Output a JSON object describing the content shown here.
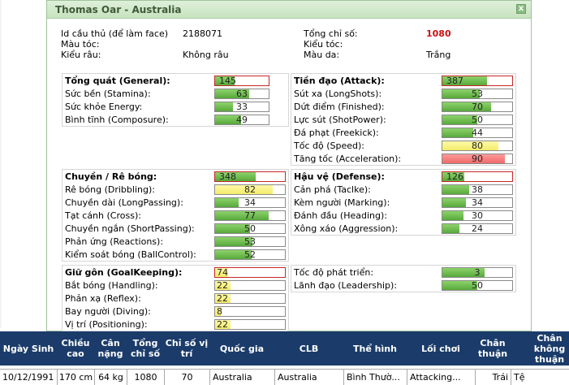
{
  "window": {
    "title": "Thomas Oar - Australia",
    "close_label": "x"
  },
  "info": {
    "player_id_label": "Id cầu thủ (để làm face)",
    "player_id_value": "2188071",
    "hair_color_label": "Màu tóc:",
    "hair_color_value": "",
    "beard_label": "Kiểu râu:",
    "beard_value": "Không râu",
    "total_label": "Tổng chỉ số:",
    "total_value": "1080",
    "hair_style_label": "Kiểu tóc:",
    "hair_style_value": "",
    "skin_label": "Màu da:",
    "skin_value": "Trắng"
  },
  "sections": {
    "general": {
      "title": "Tổng quát (General):",
      "value": "145",
      "rows": [
        {
          "label": "Sức bền (Stamina):",
          "value": "63"
        },
        {
          "label": "Sức khỏe Energy:",
          "value": "33"
        },
        {
          "label": "Bình tĩnh (Composure):",
          "value": "49"
        }
      ]
    },
    "attack": {
      "title": "Tiền đạo (Attack):",
      "value": "387",
      "rows": [
        {
          "label": "Sút xa (LongShots):",
          "value": "53"
        },
        {
          "label": "Dứt điểm (Finished):",
          "value": "70"
        },
        {
          "label": "Lực sút (ShotPower):",
          "value": "50"
        },
        {
          "label": "Đá phạt (Freekick):",
          "value": "44"
        },
        {
          "label": "Tốc độ (Speed):",
          "value": "80"
        },
        {
          "label": "Tăng tốc (Acceleration):",
          "value": "90"
        }
      ]
    },
    "dribbling": {
      "title": "Chuyền / Rê bóng:",
      "value": "348",
      "rows": [
        {
          "label": "Rê bóng (Dribbling):",
          "value": "82"
        },
        {
          "label": "Chuyền dài (LongPassing):",
          "value": "34"
        },
        {
          "label": "Tạt cánh (Cross):",
          "value": "77"
        },
        {
          "label": "Chuyền ngắn (ShortPassing):",
          "value": "50"
        },
        {
          "label": "Phản ứng (Reactions):",
          "value": "53"
        },
        {
          "label": "Kiểm soát bóng (BallControl):",
          "value": "52"
        }
      ]
    },
    "defense": {
      "title": "Hậu vệ (Defense):",
      "value": "126",
      "rows": [
        {
          "label": "Cản phá (Taclke):",
          "value": "38"
        },
        {
          "label": "Kèm người (Marking):",
          "value": "34"
        },
        {
          "label": "Đánh đầu (Heading):",
          "value": "30"
        },
        {
          "label": "Xông xáo (Aggression):",
          "value": "24"
        }
      ]
    },
    "goalkeeping": {
      "title": "Giữ gôn (GoalKeeping):",
      "value": "74",
      "rows": [
        {
          "label": "Bắt bóng (Handling):",
          "value": "22"
        },
        {
          "label": "Phản xạ (Reflex):",
          "value": "22"
        },
        {
          "label": "Bay người (Diving):",
          "value": "8"
        },
        {
          "label": "Vị trí (Positioning):",
          "value": "22"
        }
      ]
    },
    "other": {
      "rows": [
        {
          "label": "Tốc độ phát triển:",
          "value": "3"
        },
        {
          "label": "Lãnh đạo (Leadership):",
          "value": "50"
        }
      ]
    }
  },
  "table": {
    "headers": [
      "Ngày Sinh",
      "Chiều cao",
      "Cân nặng",
      "Tổng chỉ số",
      "Chỉ số vị trí",
      "Quốc gia",
      "CLB",
      "Thể hình",
      "Lối chơi",
      "Chân thuận",
      "Chân không thuận"
    ],
    "row": [
      "10/12/1991",
      "170 cm",
      "64 kg",
      "1080",
      "70",
      "Australia",
      "Australia",
      "Bình Thườ...",
      "Attacking...",
      "Trái",
      "Tệ"
    ]
  },
  "colors": {
    "green": "#58a83c",
    "yellow": "#f4ec6a",
    "red": "#ef6a6a",
    "header_bg": "#1b3c6a",
    "total_red": "#cc1111"
  }
}
